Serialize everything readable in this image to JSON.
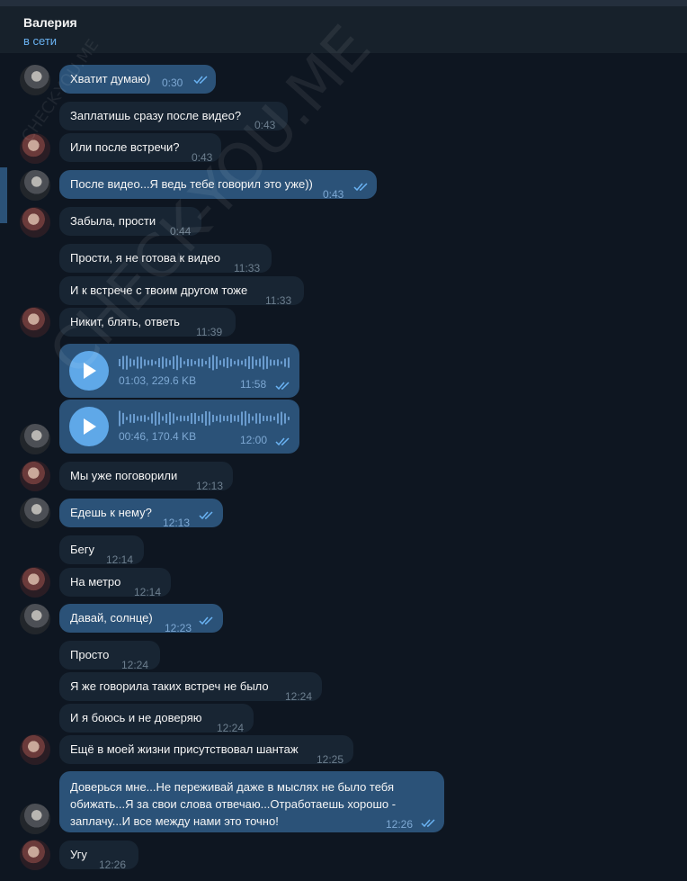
{
  "header": {
    "title": "Валерия",
    "status": "в сети"
  },
  "watermark": "CHECK-YOU.ME",
  "messages": [
    {
      "text": "Хватит думаю)",
      "time": "0:30",
      "dir": "out"
    },
    {
      "text": "Заплатишь сразу после видео?",
      "time": "0:43",
      "dir": "in"
    },
    {
      "text": "Или после встречи?",
      "time": "0:43",
      "dir": "in"
    },
    {
      "text": "После видео...Я ведь тебе говорил это уже))",
      "time": "0:43",
      "dir": "out"
    },
    {
      "text": "Забыла,  прости",
      "time": "0:44",
      "dir": "in"
    },
    {
      "text": "Прости, я не готова к видео",
      "time": "11:33",
      "dir": "in"
    },
    {
      "text": "И к встрече с твоим другом тоже",
      "time": "11:33",
      "dir": "in"
    },
    {
      "text": "Никит, блять, ответь",
      "time": "11:39",
      "dir": "in"
    },
    {
      "text": "Мы уже поговорили",
      "time": "12:13",
      "dir": "in"
    },
    {
      "text": "Едешь к нему?",
      "time": "12:13",
      "dir": "out"
    },
    {
      "text": "Бегу",
      "time": "12:14",
      "dir": "in"
    },
    {
      "text": "На метро",
      "time": "12:14",
      "dir": "in"
    },
    {
      "text": "Давай, солнце)",
      "time": "12:23",
      "dir": "out"
    },
    {
      "text": "Просто",
      "time": "12:24",
      "dir": "in"
    },
    {
      "text": "Я же говорила таких встреч не было",
      "time": "12:24",
      "dir": "in"
    },
    {
      "text": "И я боюсь и не доверяю",
      "time": "12:24",
      "dir": "in"
    },
    {
      "text": "Ещё в моей жизни присутствовал шантаж",
      "time": "12:25",
      "dir": "in"
    },
    {
      "text": "Угу",
      "time": "12:26",
      "dir": "in"
    }
  ],
  "voice": [
    {
      "meta": "01:03, 229.6 KB",
      "time": "11:58"
    },
    {
      "meta": "00:46, 170.4 KB",
      "time": "12:00"
    }
  ],
  "long_message": {
    "line1": "Доверься мне...Не переживай даже в мыслях не было тебя",
    "line2": "обижать...Я за свои слова отвечаю...Отработаешь хорошо -",
    "line3": "заплачу...И все между нами это точно!",
    "time": "12:26"
  },
  "colors": {
    "background": "#0e1621",
    "outgoing": "#2b5278",
    "incoming": "#182533",
    "accent": "#6ab3f3"
  },
  "icons": [
    "play-icon",
    "double-check-icon"
  ]
}
